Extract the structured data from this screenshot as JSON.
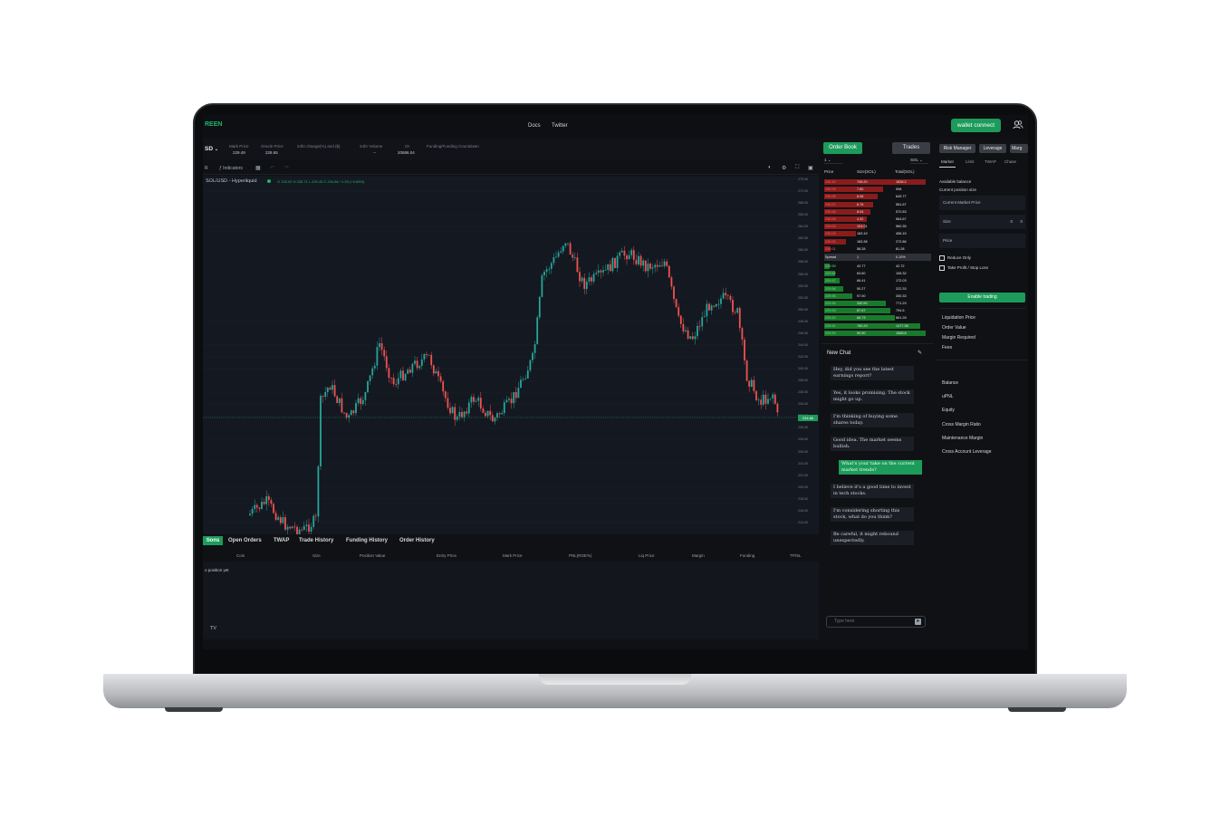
{
  "header": {
    "logo": "REEN",
    "links": [
      "Docs",
      "Twitter"
    ],
    "wallet_button": "wallet connect"
  },
  "market_info": {
    "symbol": "SD",
    "stats": [
      {
        "label": "Mark Price",
        "value": "229.49"
      },
      {
        "label": "Oracle Price",
        "value": "228.65"
      },
      {
        "label": "24hr change(%) and ($)",
        "value": ""
      },
      {
        "label": "24hr Volume",
        "value": "--"
      },
      {
        "label": "OI",
        "value": "20686.04"
      },
      {
        "label": "Funding/Funding Countdown",
        "value": ""
      }
    ]
  },
  "toolbar": {
    "indicators_label": "Indicators"
  },
  "chart": {
    "pair_label": "SOL/USD - Hyperliquid",
    "ohlc": "O 233.92  H 235.71  L 229.45  C 234.86  +1.53 (+0.65%)",
    "price_ticks": [
      "275.00",
      "272.00",
      "268.00",
      "265.00",
      "264.00",
      "262.00",
      "260.00",
      "258.00",
      "256.00",
      "254.00",
      "252.00",
      "250.00",
      "248.00",
      "246.00",
      "244.00",
      "242.00",
      "240.00",
      "238.00",
      "236.00",
      "234.00",
      "232.00",
      "230.00",
      "228.00",
      "226.00",
      "224.00",
      "222.00",
      "220.00",
      "218.00",
      "216.00",
      "214.00"
    ],
    "current_price_tag": "234.86",
    "tv_logo": "TV"
  },
  "chart_data": {
    "type": "candlestick",
    "title": "",
    "xlabel": "",
    "ylabel": "",
    "ylim": [
      212,
      276
    ]
  },
  "bottom_tabs": [
    "tions",
    "Open Orders",
    "TWAP",
    "Trade History",
    "Funding History",
    "Order History"
  ],
  "positions": {
    "columns": [
      "Coin",
      "Size",
      "Position Value",
      "Entry Price",
      "Mark Price",
      "PNL(ROE%)",
      "Liq Price",
      "Margin",
      "Funding",
      "TP/SL"
    ],
    "empty_text": "o position yet"
  },
  "orderbook": {
    "tab_active": "Order Book",
    "tab_other": "Trades",
    "grouping": "1",
    "unit": "SOL",
    "columns": [
      "Price",
      "Size(SOL)",
      "Total(SOL)"
    ],
    "asks": [
      {
        "price": "230.10",
        "size": "708.20",
        "total": "1838.2",
        "depth": 0.95
      },
      {
        "price": "230.09",
        "size": "7.80",
        "total": "598",
        "depth": 0.55
      },
      {
        "price": "230.08",
        "size": "8.06",
        "total": "649.77",
        "depth": 0.5
      },
      {
        "price": "230.07",
        "size": "8.76",
        "total": "581.67",
        "depth": 0.46
      },
      {
        "price": "230.06",
        "size": "8.04",
        "total": "572.83",
        "depth": 0.43
      },
      {
        "price": "230.05",
        "size": "4.32",
        "total": "564.67",
        "depth": 0.4
      },
      {
        "price": "230.04",
        "size": "104.01",
        "total": "560.35",
        "depth": 0.38
      },
      {
        "price": "230.03",
        "size": "183.19",
        "total": "456.15",
        "depth": 0.3
      },
      {
        "price": "230.02",
        "size": "183.38",
        "total": "272.86",
        "depth": 0.2
      },
      {
        "price": "230.01",
        "size": "58.28",
        "total": "81.28",
        "depth": 0.06
      }
    ],
    "spread": {
      "label": "Spread",
      "value": "1",
      "pct": "0.10%"
    },
    "bids": [
      {
        "price": "229.99",
        "size": "42.77",
        "total": "42.72",
        "depth": 0.05
      },
      {
        "price": "229.98",
        "size": "63.60",
        "total": "106.32",
        "depth": 0.1
      },
      {
        "price": "229.97",
        "size": "66.41",
        "total": "172.03",
        "depth": 0.14
      },
      {
        "price": "229.96",
        "size": "50.27",
        "total": "222.33",
        "depth": 0.18
      },
      {
        "price": "229.95",
        "size": "97.00",
        "total": "330.33",
        "depth": 0.26
      },
      {
        "price": "229.94",
        "size": "330.50",
        "total": "771.23",
        "depth": 0.58
      },
      {
        "price": "229.93",
        "size": "87.67",
        "total": "794.6",
        "depth": 0.62
      },
      {
        "price": "229.92",
        "size": "66.73",
        "total": "861.28",
        "depth": 0.66
      },
      {
        "price": "229.91",
        "size": "760.29",
        "total": "1477.58",
        "depth": 0.9
      },
      {
        "price": "229.90",
        "size": "90.90",
        "total": "1568.8",
        "depth": 0.95
      }
    ]
  },
  "chat": {
    "title": "New Chat",
    "messages": [
      {
        "text": "Hey, did you see the latest earnings report?",
        "own": false
      },
      {
        "text": "Yes, it looks promising. The stock might go up.",
        "own": false
      },
      {
        "text": "I'm thinking of buying some shares today.",
        "own": false
      },
      {
        "text": "Good idea. The market seems bullish.",
        "own": false
      },
      {
        "text": "What's your take on the current market trends?",
        "own": true
      },
      {
        "text": "I believe it's a good time to invest in tech stocks.",
        "own": false
      },
      {
        "text": "I'm considering shorting this stock, what do you think?",
        "own": false
      },
      {
        "text": "Be careful, it might rebound unexpectedly.",
        "own": false
      }
    ],
    "input_placeholder": "Type here"
  },
  "trade_panel": {
    "tabs": [
      "Risk Manager",
      "Leverage",
      "Marg"
    ],
    "order_types": [
      "Market",
      "Limit",
      "TWAP",
      "Chase"
    ],
    "available_balance": "Available balance",
    "current_position": "Current position size",
    "current_market_price": "Current Market Price",
    "size_label": "Size",
    "size_value": "0",
    "price_label": "Price",
    "reduce_only": "Reduce Only",
    "tp_sl": "Take Profit / Stop Loss",
    "enable_trading": "Enable trading",
    "summary": [
      "Liquidation Price",
      "Order Value",
      "Margin Required",
      "Fees"
    ],
    "account": [
      "Balance",
      "uPNL",
      "Equity",
      "Cross Margin Ratio",
      "Maintenance Margin",
      "Cross Account Leverage"
    ]
  }
}
